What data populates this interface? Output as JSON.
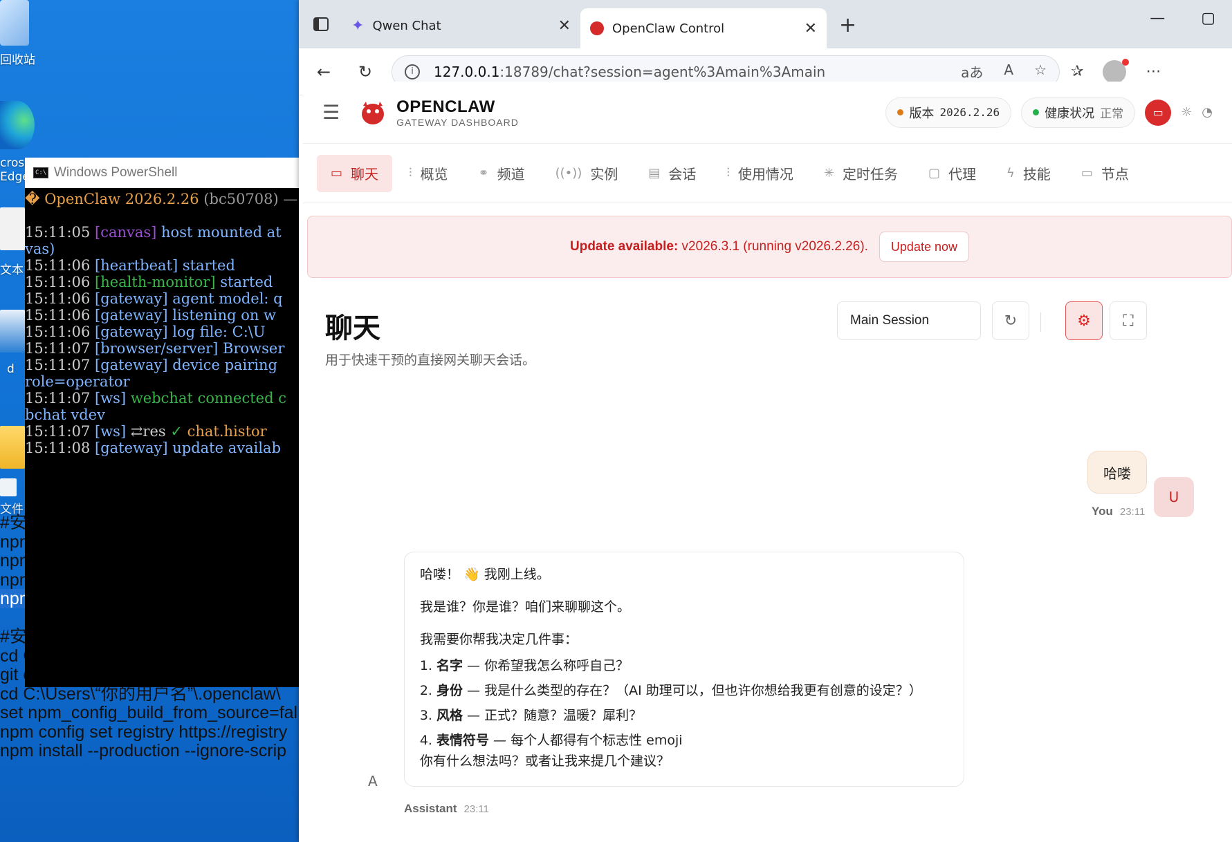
{
  "desktop": {
    "icons": [
      {
        "label": "回收站",
        "icon": "recycle-bin-icon"
      },
      {
        "label": "crosoft\nEdge",
        "icon": "edge-icon"
      },
      {
        "label": "文本",
        "icon": "text-file-icon"
      },
      {
        "label": "d",
        "icon": "powershell-shortcut-icon"
      },
      {
        "label": "",
        "icon": "folder-icon"
      },
      {
        "label": "文件",
        "icon": "file-icon"
      }
    ],
    "notepad_lines": [
      "#安装",
      "npm",
      "npm",
      "npm",
      "npm",
      "",
      "#安装",
      "cd C",
      "git clone https://github.com/soimy/cla",
      "cd C:\\Users\\“你的用户名”\\.openclaw\\",
      "set npm_config_build_from_source=fal",
      "npm config set registry https://registry",
      "npm install --production --ignore-scrip"
    ],
    "notepad_selected_line": 4
  },
  "powershell": {
    "title": "Windows PowerShell",
    "lines": [
      [
        {
          "t": "� OpenClaw 2026.2.26 ",
          "c": "c-org"
        },
        {
          "t": "(bc50708) —",
          "c": "c-gry"
        }
      ],
      [
        {
          "t": "",
          "c": ""
        }
      ],
      [
        {
          "t": "15:11:05 ",
          "c": ""
        },
        {
          "t": "[canvas]",
          "c": "c-pur"
        },
        {
          "t": " host mounted at",
          "c": "c-blu"
        }
      ],
      [
        {
          "t": "vas)",
          "c": "c-blu"
        }
      ],
      [
        {
          "t": "15:11:06 ",
          "c": ""
        },
        {
          "t": "[heartbeat] started",
          "c": "c-blu"
        }
      ],
      [
        {
          "t": "15:11:06 ",
          "c": ""
        },
        {
          "t": "[health-monitor]",
          "c": "c-grn"
        },
        {
          "t": " started",
          "c": "c-blu"
        }
      ],
      [
        {
          "t": "15:11:06 ",
          "c": ""
        },
        {
          "t": "[gateway] agent model: q",
          "c": "c-blu"
        }
      ],
      [
        {
          "t": "15:11:06 ",
          "c": ""
        },
        {
          "t": "[gateway] listening on w",
          "c": "c-blu"
        }
      ],
      [
        {
          "t": "15:11:06 ",
          "c": ""
        },
        {
          "t": "[gateway] log file: C:\\U",
          "c": "c-blu"
        }
      ],
      [
        {
          "t": "15:11:07 ",
          "c": ""
        },
        {
          "t": "[browser/server] Browser",
          "c": "c-blu"
        }
      ],
      [
        {
          "t": "15:11:07 ",
          "c": ""
        },
        {
          "t": "[gateway] device pairing",
          "c": "c-blu"
        }
      ],
      [
        {
          "t": "role=operator",
          "c": "c-blu"
        }
      ],
      [
        {
          "t": "15:11:07 ",
          "c": ""
        },
        {
          "t": "[ws]",
          "c": "c-blu"
        },
        {
          "t": " webchat connected c",
          "c": "c-grn"
        }
      ],
      [
        {
          "t": "bchat vdev",
          "c": "c-blu"
        }
      ],
      [
        {
          "t": "15:11:07 ",
          "c": ""
        },
        {
          "t": "[ws]",
          "c": "c-blu"
        },
        {
          "t": " ⇄res ",
          "c": ""
        },
        {
          "t": "✓",
          "c": "c-grn"
        },
        {
          "t": " chat.histor",
          "c": "c-org"
        }
      ],
      [
        {
          "t": "15:11:08 ",
          "c": ""
        },
        {
          "t": "[gateway] update availab",
          "c": "c-blu"
        }
      ]
    ]
  },
  "browser": {
    "tabs": [
      {
        "title": "Qwen Chat",
        "icon": "qwen-icon",
        "active": false
      },
      {
        "title": "OpenClaw Control",
        "icon": "openclaw-icon",
        "active": true
      }
    ],
    "url_host": "127.0.0.1",
    "url_rest": ":18789/chat?session=agent%3Amain%3Amain",
    "read_aloud_icon": "A",
    "translate_icon": "aあ"
  },
  "app": {
    "brand": "OPENCLAW",
    "brand_sub": "GATEWAY DASHBOARD",
    "version_label": "版本",
    "version": "2026.2.26",
    "health_label": "健康状况",
    "health_status": "正常",
    "colors": {
      "accent": "#c72424",
      "version_dot": "#e07a14",
      "health_dot": "#22b14c"
    },
    "nav": [
      {
        "label": "聊天",
        "icon": "chat-icon",
        "glyph": "▭"
      },
      {
        "label": "概览",
        "icon": "bar-chart-icon",
        "glyph": "⫶"
      },
      {
        "label": "频道",
        "icon": "link-icon",
        "glyph": "⚭"
      },
      {
        "label": "实例",
        "icon": "radio-icon",
        "glyph": "((•))"
      },
      {
        "label": "会话",
        "icon": "document-icon",
        "glyph": "▤"
      },
      {
        "label": "使用情况",
        "icon": "usage-chart-icon",
        "glyph": "⫶"
      },
      {
        "label": "定时任务",
        "icon": "loader-icon",
        "glyph": "✳"
      },
      {
        "label": "代理",
        "icon": "folder-icon",
        "glyph": "▢"
      },
      {
        "label": "技能",
        "icon": "lightning-icon",
        "glyph": "ϟ"
      },
      {
        "label": "节点",
        "icon": "monitor-icon",
        "glyph": "▭"
      }
    ],
    "banner": {
      "prefix": "Update available:",
      "text": " v2026.3.1 (running v2026.2.26).",
      "button": "Update now"
    },
    "chat": {
      "title": "聊天",
      "subtitle": "用于快速干预的直接网关聊天会话。",
      "session": "Main Session",
      "messages": {
        "user": {
          "text": "哈喽",
          "author": "You",
          "time": "23:11",
          "avatar": "U"
        },
        "assistant": {
          "p1": "哈喽！ 👋 我刚上线。",
          "p2": "我是谁？你是谁？咱们来聊聊这个。",
          "p3": "我需要你帮我决定几件事：",
          "items": [
            {
              "b": "名字",
              "t": " — 你希望我怎么称呼自己？"
            },
            {
              "b": "身份",
              "t": " — 我是什么类型的存在？（AI 助理可以，但也许你想给我更有创意的设定？）"
            },
            {
              "b": "风格",
              "t": " — 正式？随意？温暖？犀利？"
            },
            {
              "b": "表情符号",
              "t": " — 每个人都得有个标志性 emoji"
            }
          ],
          "p4": "你有什么想法吗？或者让我来提几个建议？",
          "author": "Assistant",
          "time": "23:11",
          "avatar": "A"
        }
      }
    }
  }
}
